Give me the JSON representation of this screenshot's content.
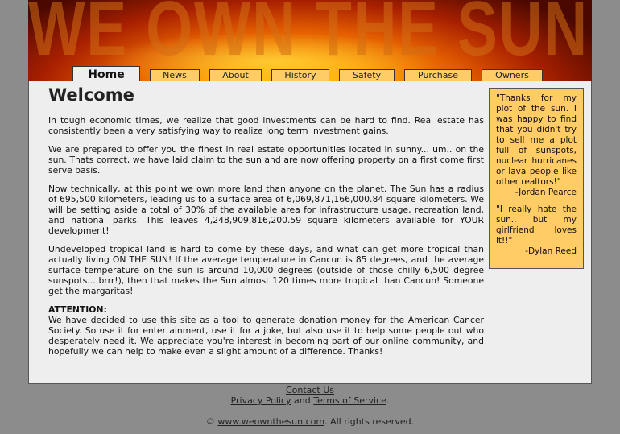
{
  "banner": {
    "title": "WE OWN THE SUN"
  },
  "nav": {
    "home": "Home",
    "tabs": [
      "News",
      "About",
      "History",
      "Safety",
      "Purchase",
      "Owners"
    ]
  },
  "main": {
    "heading": "Welcome",
    "paragraphs": [
      "In tough economic times, we realize that good investments can be hard to find. Real estate has consistently been a very satisfying way to realize long term investment gains.",
      "We are prepared to offer you the finest in real estate opportunities located in sunny... um.. on the sun. Thats correct, we have laid claim to the sun and are now offering property on a first come first serve basis.",
      "Now technically, at this point we own more land than anyone on the planet. The Sun has a radius of 695,500 kilometers, leading us to a surface area of 6,069,871,166,000.84 square kilometers. We will be setting aside a total of 30% of the available area for infrastructure usage, recreation land, and national parks. This leaves 4,248,909,816,200.59 square kilometers available for YOUR development!",
      "Undeveloped tropical land is hard to come by these days, and what can get more tropical than actually living ON THE SUN! If the average temperature in Cancun is 85 degrees, and the average surface temperature on the sun is around 10,000 degrees (outside of those chilly 6,500 degree sunspots... brrr!), then that makes the Sun almost 120 times more tropical than Cancun! Someone get the margaritas!"
    ],
    "attention_title": "ATTENTION:",
    "attention_text": "We have decided to use this site as a tool to generate donation money for the American Cancer Society. So use it for entertainment, use it for a joke, but also use it to help some people out who desperately need it. We appreciate you're interest in becoming part of our online community, and hopefully we can help to make even a slight amount of a difference. Thanks!"
  },
  "quotes": [
    {
      "text": "\"Thanks for my plot of the sun. I was happy to find that you didn't try to sell me a plot full of sunspots, nuclear hurricanes or lava people like other realtors!\"",
      "author": "-Jordan Pearce"
    },
    {
      "text": "\"I really hate the sun.. but my girlfriend loves it!!\"",
      "author": "-Dylan Reed"
    }
  ],
  "footer": {
    "contact": "Contact Us",
    "privacy": "Privacy Policy",
    "and": " and ",
    "terms": "Terms of Service",
    "period": ".",
    "copyright_symbol": "© ",
    "site_link": "www.weownthesun.com",
    "rights": ". All rights reserved."
  }
}
